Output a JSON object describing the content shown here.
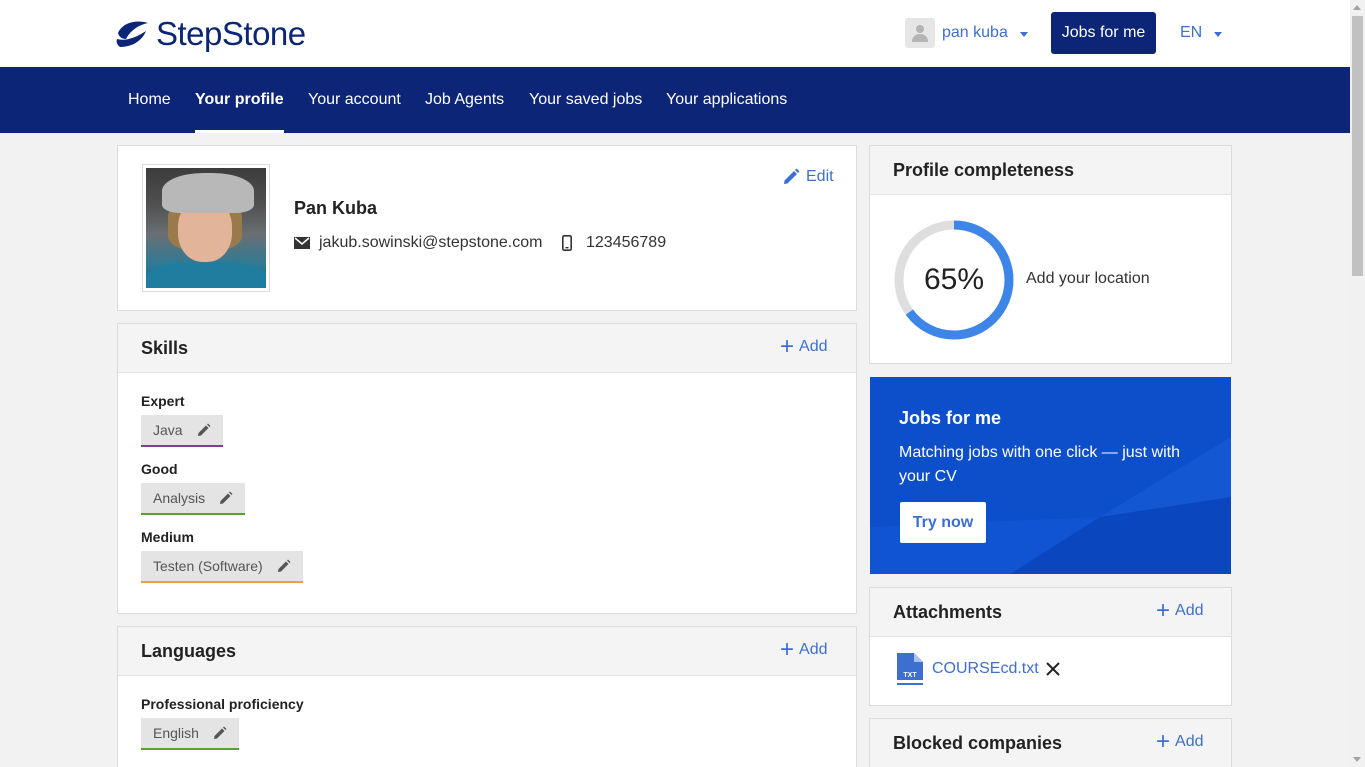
{
  "brand": {
    "name": "StepStone",
    "color": "#0c2577",
    "accent": "#3d6fd1"
  },
  "header": {
    "user_name": "pan kuba",
    "jobs_button": "Jobs for me",
    "language": "EN"
  },
  "nav": {
    "items": [
      {
        "label": "Home",
        "active": false
      },
      {
        "label": "Your profile",
        "active": true
      },
      {
        "label": "Your account",
        "active": false
      },
      {
        "label": "Job Agents",
        "active": false
      },
      {
        "label": "Your saved jobs",
        "active": false
      },
      {
        "label": "Your applications",
        "active": false
      }
    ]
  },
  "profile": {
    "name": "Pan Kuba",
    "email": "jakub.sowinski@stepstone.com",
    "phone": "123456789",
    "edit_label": "Edit"
  },
  "skills": {
    "title": "Skills",
    "add_label": "Add",
    "groups": [
      {
        "level": "Expert",
        "skill": "Java",
        "color": "#7b3f8c"
      },
      {
        "level": "Good",
        "skill": "Analysis",
        "color": "#5aa32a"
      },
      {
        "level": "Medium",
        "skill": "Testen (Software)",
        "color": "#e8a33b"
      }
    ]
  },
  "languages": {
    "title": "Languages",
    "add_label": "Add",
    "groups": [
      {
        "level": "Professional proficiency",
        "language": "English",
        "color": "#5aa32a"
      }
    ]
  },
  "completeness": {
    "title": "Profile completeness",
    "percent_label": "65%",
    "percent": 65,
    "hint": "Add your location"
  },
  "promo": {
    "title": "Jobs for me",
    "text": "Matching jobs with one click — just with your CV",
    "button": "Try now"
  },
  "attachments": {
    "title": "Attachments",
    "add_label": "Add",
    "file_name": "COURSEcd.txt",
    "file_type": "TXT"
  },
  "blocked": {
    "title": "Blocked companies",
    "add_label": "Add"
  }
}
